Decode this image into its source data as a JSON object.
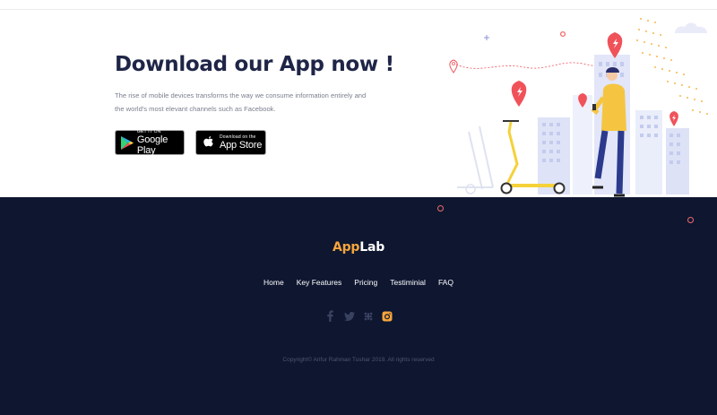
{
  "download": {
    "title": "Download our App now !",
    "text": "The rise of mobile devices transforms the way we consume information entirely and the world's most elevant channels such as Facebook.",
    "google_play": {
      "small": "GET IT ON",
      "big": "Google Play"
    },
    "app_store": {
      "small": "Download on the",
      "big": "App Store"
    }
  },
  "footer": {
    "brand_app": "App",
    "brand_lab": "Lab",
    "nav": [
      "Home",
      "Key Features",
      "Pricing",
      "Testiminial",
      "FAQ"
    ],
    "social_icons": [
      "facebook-icon",
      "twitter-icon",
      "slack-icon",
      "instagram-icon"
    ],
    "copyright": "Copyright© Arifur Rahman Tushar 2019. All rights reserved"
  },
  "colors": {
    "accent_orange": "#f5a53c",
    "footer_bg": "#0e1630",
    "title": "#1f2547",
    "pin_red": "#f0525a",
    "scooter_yellow": "#f5d13a"
  }
}
